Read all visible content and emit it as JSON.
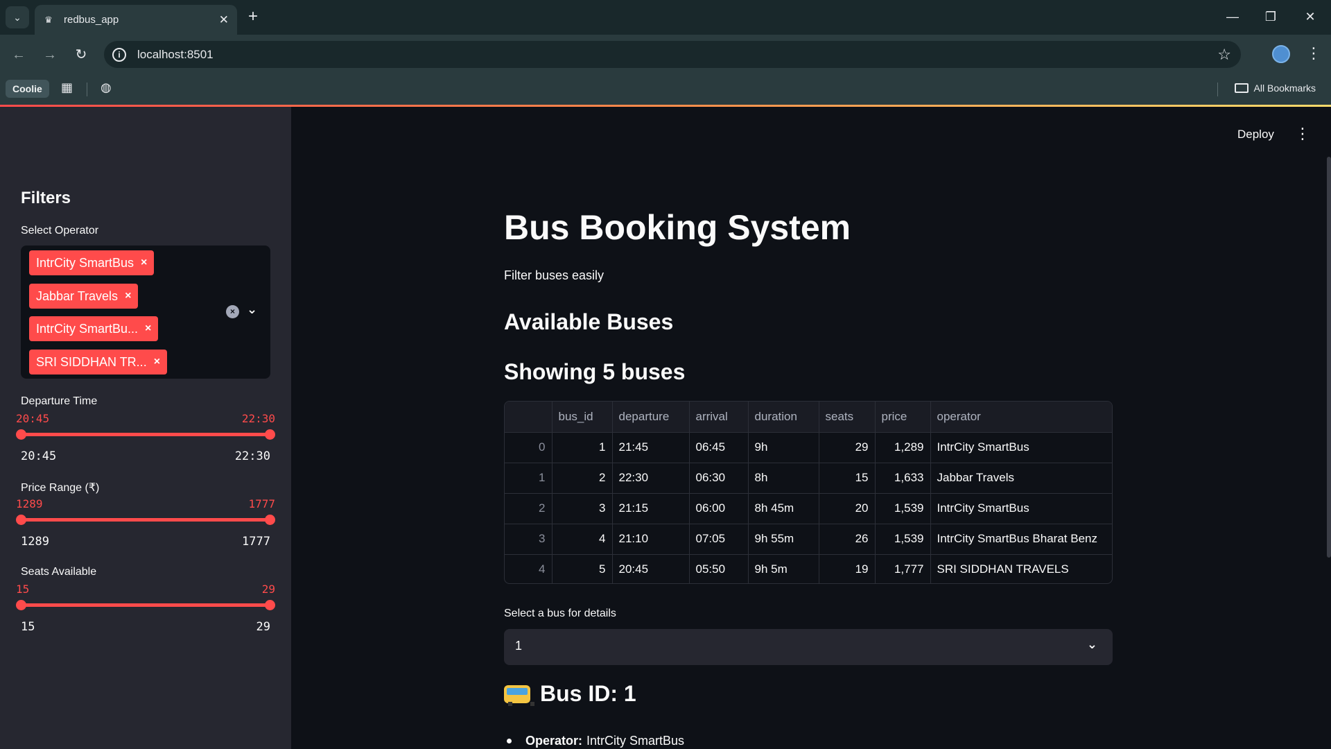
{
  "browser": {
    "tab_title": "redbus_app",
    "url": "localhost:8501",
    "bookmark_coolie": "Coolie",
    "all_bookmarks": "All Bookmarks"
  },
  "app": {
    "deploy_label": "Deploy"
  },
  "sidebar": {
    "title": "Filters",
    "operator_label": "Select Operator",
    "selected_operators": [
      "IntrCity SmartBus",
      "Jabbar Travels",
      "IntrCity SmartBu...",
      "SRI SIDDHAN TR..."
    ],
    "departure": {
      "label": "Departure Time",
      "low": "20:45",
      "high": "22:30",
      "min": "20:45",
      "max": "22:30"
    },
    "price": {
      "label": "Price Range (₹)",
      "low": "1289",
      "high": "1777",
      "min": "1289",
      "max": "1777"
    },
    "seats": {
      "label": "Seats Available",
      "low": "15",
      "high": "29",
      "min": "15",
      "max": "29"
    }
  },
  "main": {
    "title": "Bus Booking System",
    "subtitle": "Filter buses easily",
    "available_heading": "Available Buses",
    "showing_heading": "Showing 5 buses",
    "table": {
      "columns": [
        "",
        "bus_id",
        "departure",
        "arrival",
        "duration",
        "seats",
        "price",
        "operator"
      ],
      "rows": [
        [
          "0",
          "1",
          "21:45",
          "06:45",
          "9h",
          "29",
          "1,289",
          "IntrCity SmartBus"
        ],
        [
          "1",
          "2",
          "22:30",
          "06:30",
          "8h",
          "15",
          "1,633",
          "Jabbar Travels"
        ],
        [
          "2",
          "3",
          "21:15",
          "06:00",
          "8h 45m",
          "20",
          "1,539",
          "IntrCity SmartBus"
        ],
        [
          "3",
          "4",
          "21:10",
          "07:05",
          "9h 55m",
          "26",
          "1,539",
          "IntrCity SmartBus Bharat Benz"
        ],
        [
          "4",
          "5",
          "20:45",
          "05:50",
          "9h 5m",
          "19",
          "1,777",
          "SRI SIDDHAN TRAVELS"
        ]
      ]
    },
    "select_label": "Select a bus for details",
    "selected_bus": "1",
    "bus_heading": "Bus ID: 1",
    "detail_operator_label": "Operator:",
    "detail_operator_value": "IntrCity SmartBus"
  }
}
